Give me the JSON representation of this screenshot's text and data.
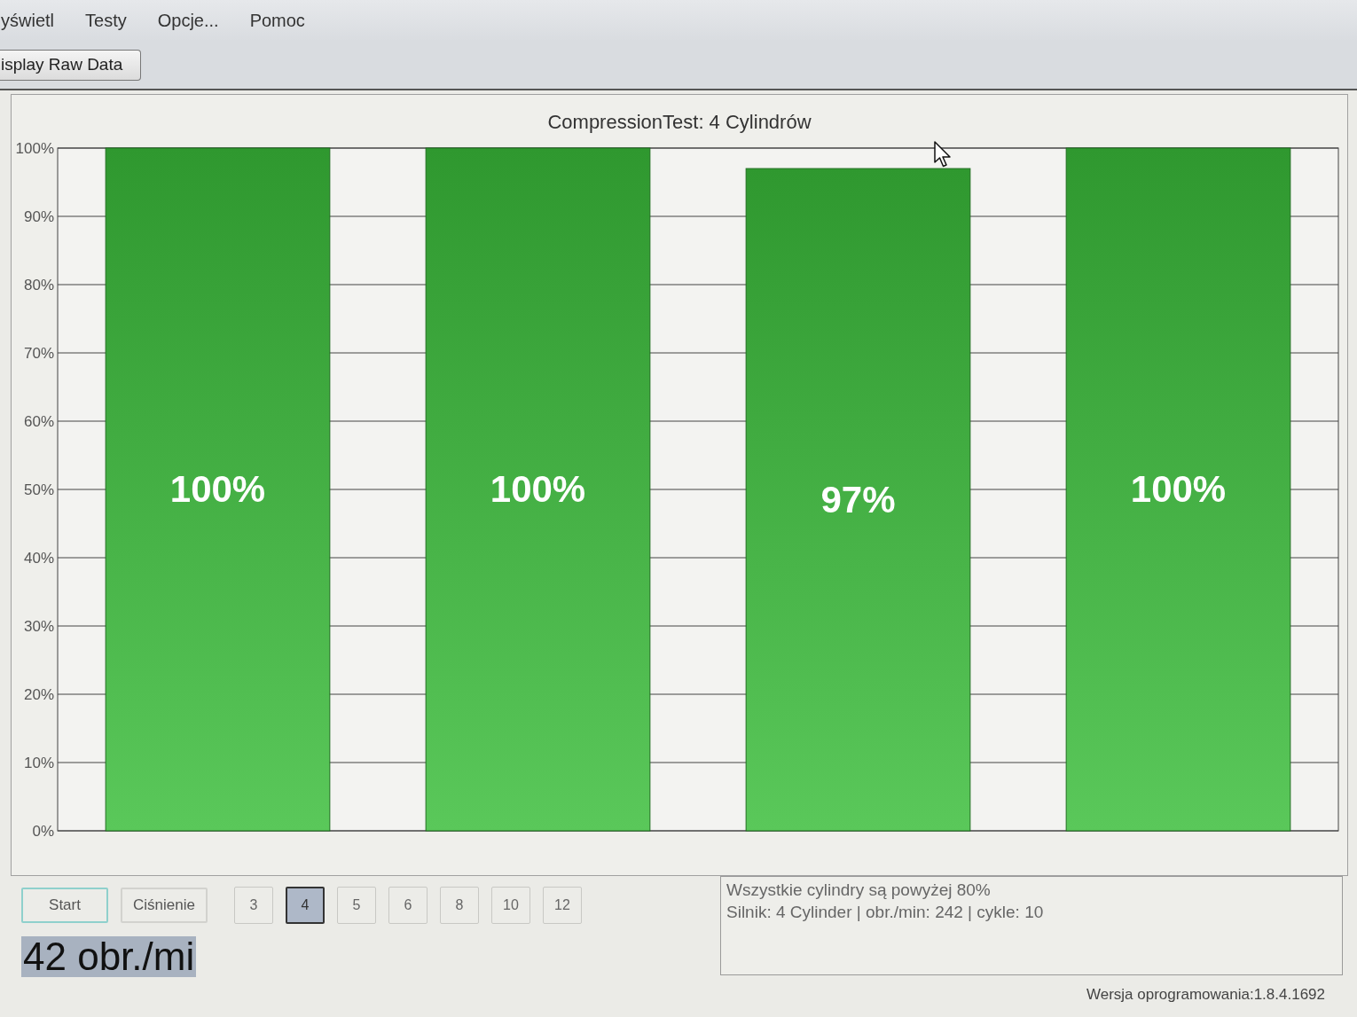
{
  "menu": {
    "items": [
      {
        "label": "yświetl"
      },
      {
        "label": "Testy"
      },
      {
        "label": "Opcje..."
      },
      {
        "label": "Pomoc"
      }
    ]
  },
  "toolbar": {
    "buttons": [
      {
        "label": "isplay Raw Data"
      }
    ]
  },
  "chart": {
    "chart_data": {
      "type": "bar",
      "title": "CompressionTest: 4 Cylindrów",
      "values": [
        100,
        100,
        97,
        100
      ],
      "ylim": [
        0,
        100
      ],
      "yticks": [
        {
          "value": 0,
          "label": "0%"
        },
        {
          "value": 10,
          "label": "10%"
        },
        {
          "value": 20,
          "label": "20%"
        },
        {
          "value": 30,
          "label": "30%"
        },
        {
          "value": 40,
          "label": "40%"
        },
        {
          "value": 50,
          "label": "50%"
        },
        {
          "value": 60,
          "label": "60%"
        },
        {
          "value": 70,
          "label": "70%"
        },
        {
          "value": 80,
          "label": "80%"
        },
        {
          "value": 90,
          "label": "90%"
        },
        {
          "value": 100,
          "label": "100%"
        }
      ],
      "grid": true,
      "value_labels": [
        "100%",
        "100%",
        "97%",
        "100%"
      ]
    }
  },
  "action_buttons": [
    {
      "label": "Start",
      "focused": true
    },
    {
      "label": "Ciśnienie",
      "focused": false
    }
  ],
  "cylinder_buttons": [
    {
      "label": "3",
      "selected": false
    },
    {
      "label": "4",
      "selected": true
    },
    {
      "label": "5",
      "selected": false
    },
    {
      "label": "6",
      "selected": false
    },
    {
      "label": "8",
      "selected": false
    },
    {
      "label": "10",
      "selected": false
    },
    {
      "label": "12",
      "selected": false
    }
  ],
  "rpm_display": {
    "text": "42 obr./mi"
  },
  "status_box": {
    "lines": [
      "Wszystkie cylindry są powyżej 80%",
      "Silnik: 4 Cylinder | obr./min: 242 | cykle: 10"
    ]
  },
  "version": "Wersja oprogramowania:1.8.4.1692"
}
